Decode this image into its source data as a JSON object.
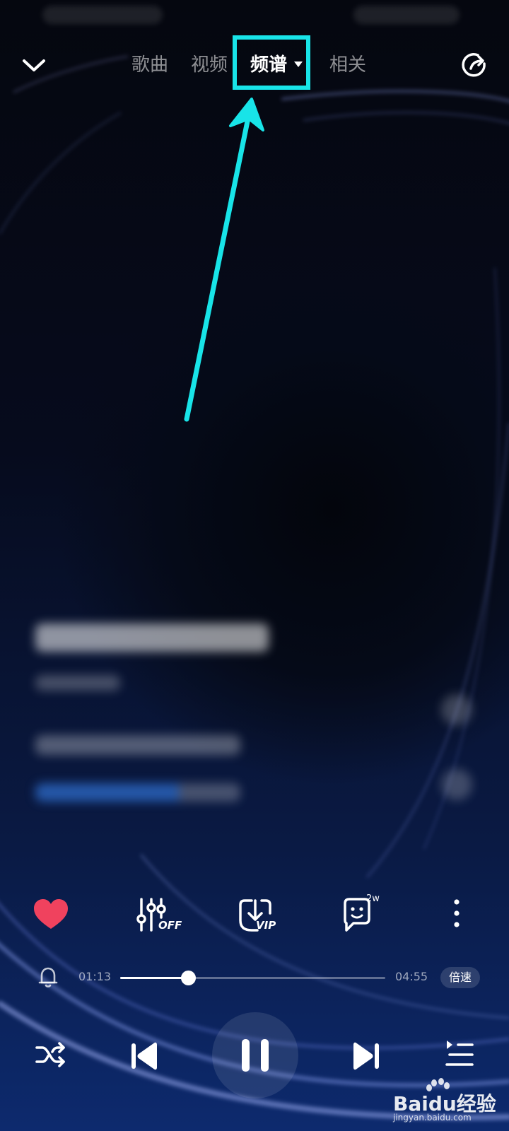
{
  "tabs": [
    {
      "label": "歌曲"
    },
    {
      "label": "视频"
    },
    {
      "label": "频谱"
    },
    {
      "label": "相关"
    }
  ],
  "actions": {
    "comment_count": "2w",
    "effects_badge": "OFF",
    "download_badge": "VIP"
  },
  "player": {
    "current_time": "01:13",
    "total_time": "04:55",
    "progress": 0.255,
    "speed_label": "倍速"
  },
  "watermark": {
    "text": "Baidu经验",
    "url": "jingyan.baidu.com"
  },
  "colors": {
    "highlight": "#18e4e8",
    "liked": "#f0425e"
  },
  "icons": [
    "chevron-down-icon",
    "share-icon",
    "heart-icon",
    "equalizer-icon",
    "download-icon",
    "comment-icon",
    "more-icon",
    "bell-icon",
    "shuffle-icon",
    "previous-icon",
    "pause-icon",
    "next-icon",
    "playlist-icon"
  ]
}
